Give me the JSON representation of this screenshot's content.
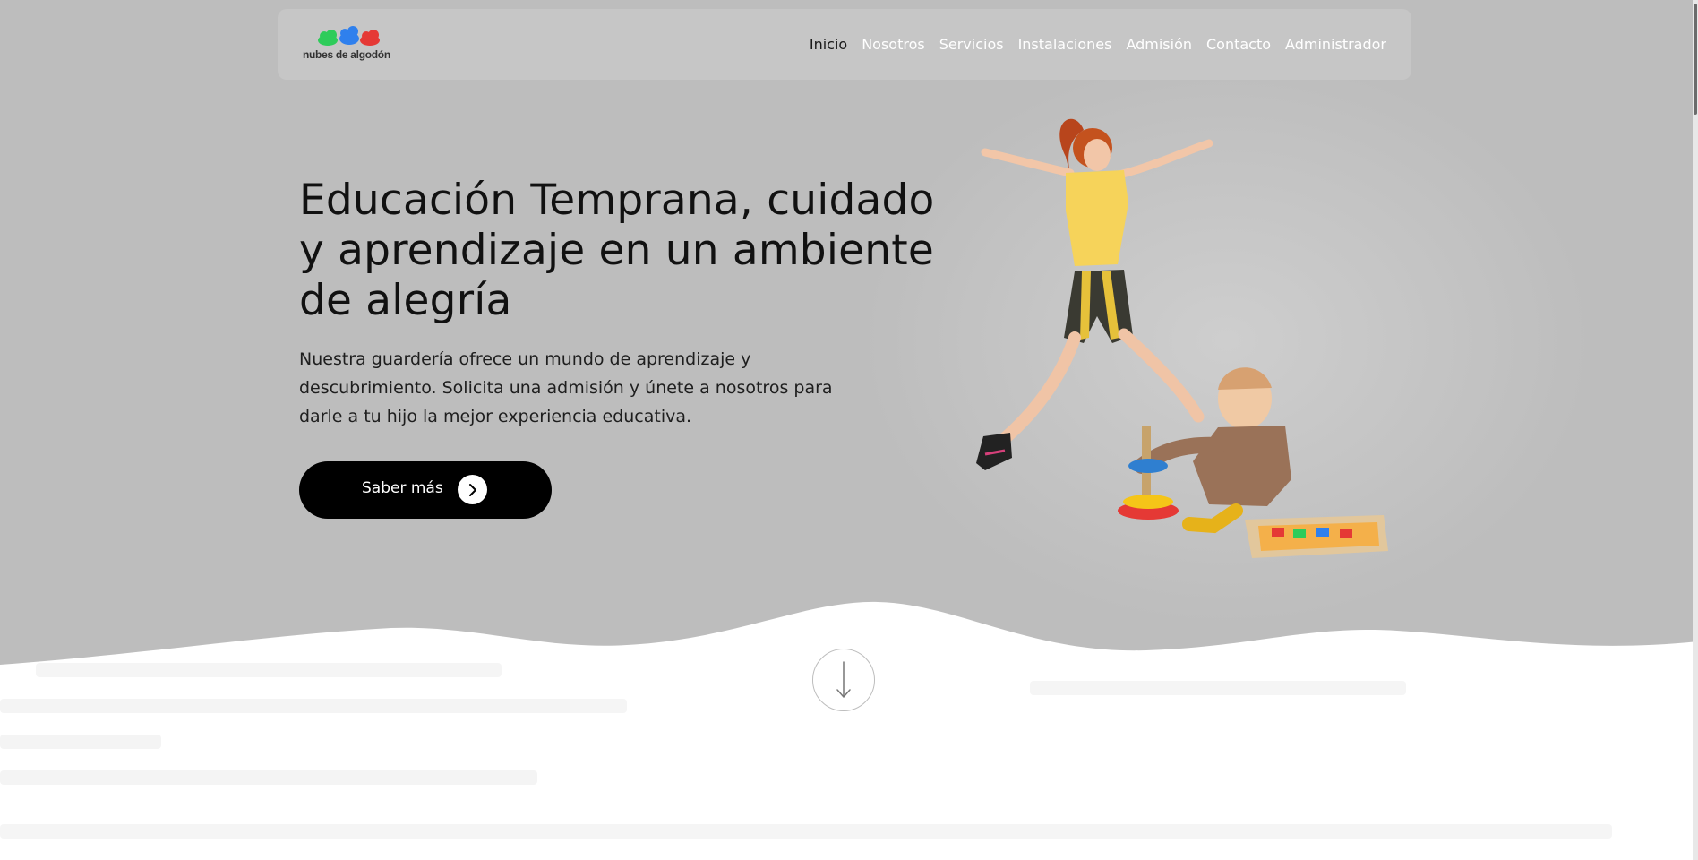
{
  "brand": {
    "name": "nubes de algodón",
    "cloud_colors": [
      "#2ecc5a",
      "#2f80ed",
      "#e53935"
    ]
  },
  "nav": {
    "items": [
      {
        "label": "Inicio",
        "active": true
      },
      {
        "label": "Nosotros",
        "active": false
      },
      {
        "label": "Servicios",
        "active": false
      },
      {
        "label": "Instalaciones",
        "active": false
      },
      {
        "label": "Admisión",
        "active": false
      },
      {
        "label": "Contacto",
        "active": false
      },
      {
        "label": "Administrador",
        "active": false
      }
    ]
  },
  "hero": {
    "headline": "Educación Temprana, cuidado y aprendizaje en un ambiente de alegría",
    "description": "Nuestra guardería ofrece un mundo de aprendizaje y descubrimiento. Solicita una admisión y únete a nosotros para darle a tu hijo la mejor experiencia educativa.",
    "cta_label": "Saber más",
    "cta_icon": "chevron-right-icon",
    "image": "girl-jumping-and-baby-playing-photo"
  },
  "scroll_down": {
    "icon": "arrow-down-icon"
  },
  "colors": {
    "hero_bg": "#bdbdbd",
    "navbar_bg": "#c6c6c6",
    "nav_link": "#ffffff",
    "nav_active": "#1a1a1a",
    "cta_bg": "#000000",
    "text": "#111111"
  }
}
